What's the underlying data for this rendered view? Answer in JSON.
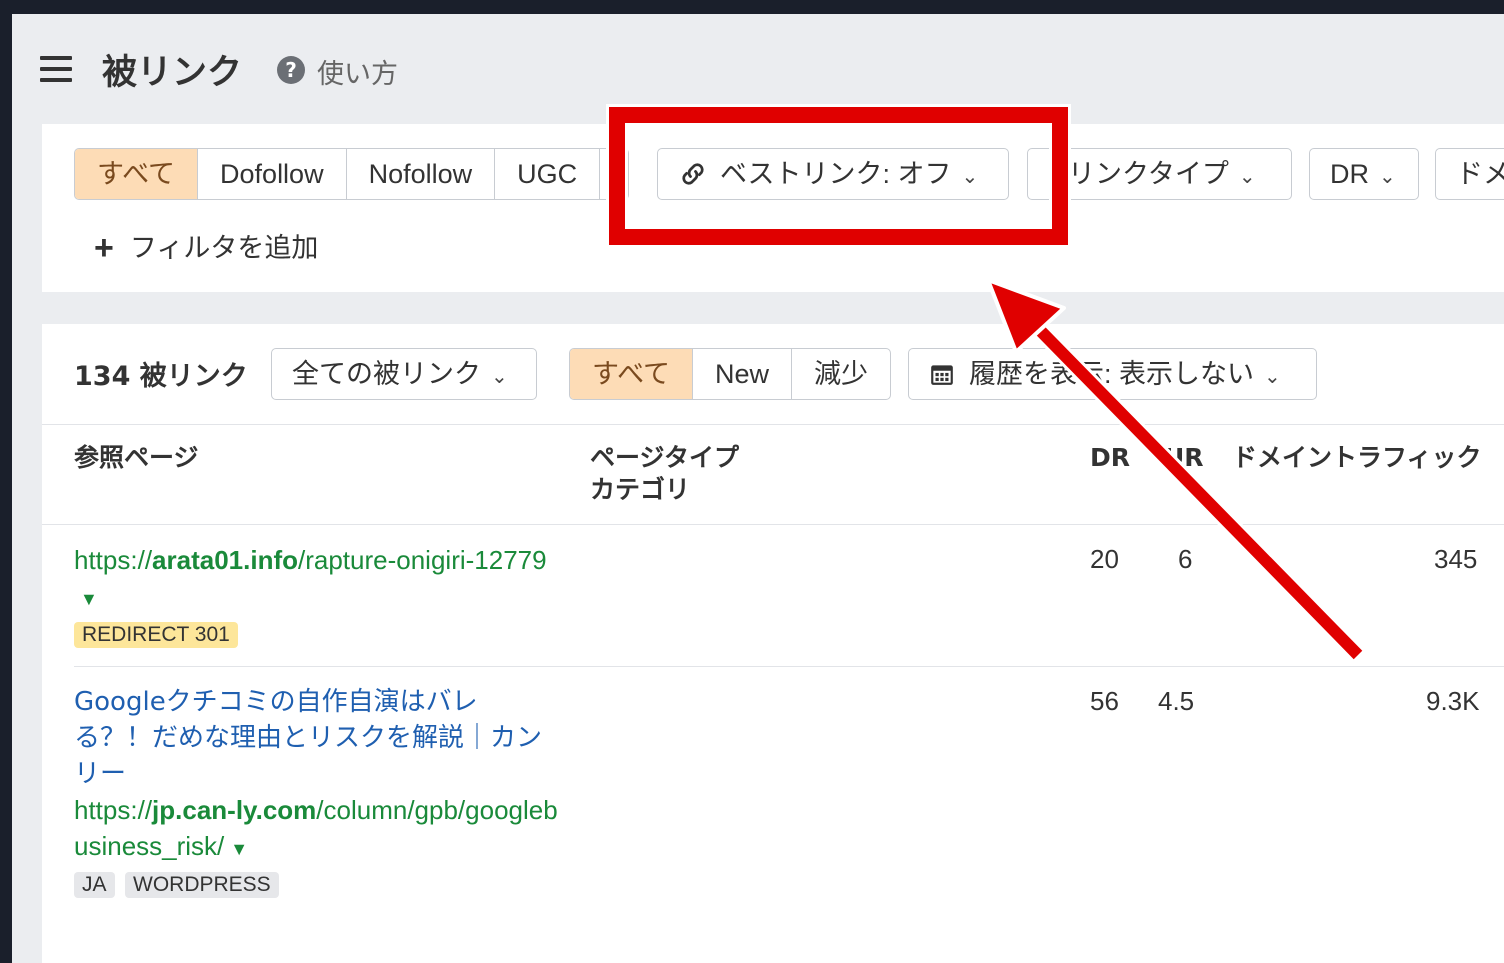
{
  "header": {
    "title": "被リンク",
    "help_label": "使い方"
  },
  "filters": {
    "link_types": [
      {
        "label": "すべて",
        "active": true
      },
      {
        "label": "Dofollow",
        "active": false
      },
      {
        "label": "Nofollow",
        "active": false
      },
      {
        "label": "UGC",
        "active": false
      }
    ],
    "best_links_dropdown": "ベストリンク: オフ",
    "link_type_dropdown": "リンクタイプ",
    "dr_dropdown": "DR",
    "domain_dropdown": "ドメ",
    "add_filter": "フィルタを追加"
  },
  "results": {
    "count_label": "134 被リンク",
    "scope_dropdown": "全ての被リンク",
    "tabs": [
      {
        "label": "すべて",
        "active": true
      },
      {
        "label": "New",
        "active": false
      },
      {
        "label": "減少",
        "active": false
      }
    ],
    "history_dropdown": "履歴を表示: 表示しない",
    "columns": {
      "ref_page": "参照ページ",
      "page_type_line1": "ページタイプ",
      "page_type_line2": "カテゴリ",
      "dr": "DR",
      "ur": "UR",
      "domain_traffic": "ドメイントラフィック"
    },
    "rows": [
      {
        "title": "",
        "url_prefix": "https://",
        "url_domain": "arata01.info",
        "url_path": "/rapture-onigiri-12779",
        "badges": [
          "REDIRECT 301"
        ],
        "dr": "20",
        "ur": "6",
        "traffic": "345"
      },
      {
        "title": "Googleクチコミの自作自演はバレる？！だめな理由とリスクを解説｜カンリー",
        "url_prefix": "https://",
        "url_domain": "jp.can-ly.com",
        "url_path": "/column/gpb/googlebusiness_risk/",
        "badges": [
          "JA",
          "WORDPRESS"
        ],
        "dr": "56",
        "ur": "4.5",
        "traffic": "9.3K"
      }
    ]
  },
  "colors": {
    "active_segment": "#fddcb6",
    "url_green": "#1a8a3a",
    "title_blue": "#1f5fb0",
    "annotation_red": "#e00000"
  },
  "icons": [
    "menu-icon",
    "help-icon",
    "link-icon",
    "chevron-down-icon",
    "plus-icon",
    "calendar-icon",
    "dropdown-caret-icon"
  ]
}
